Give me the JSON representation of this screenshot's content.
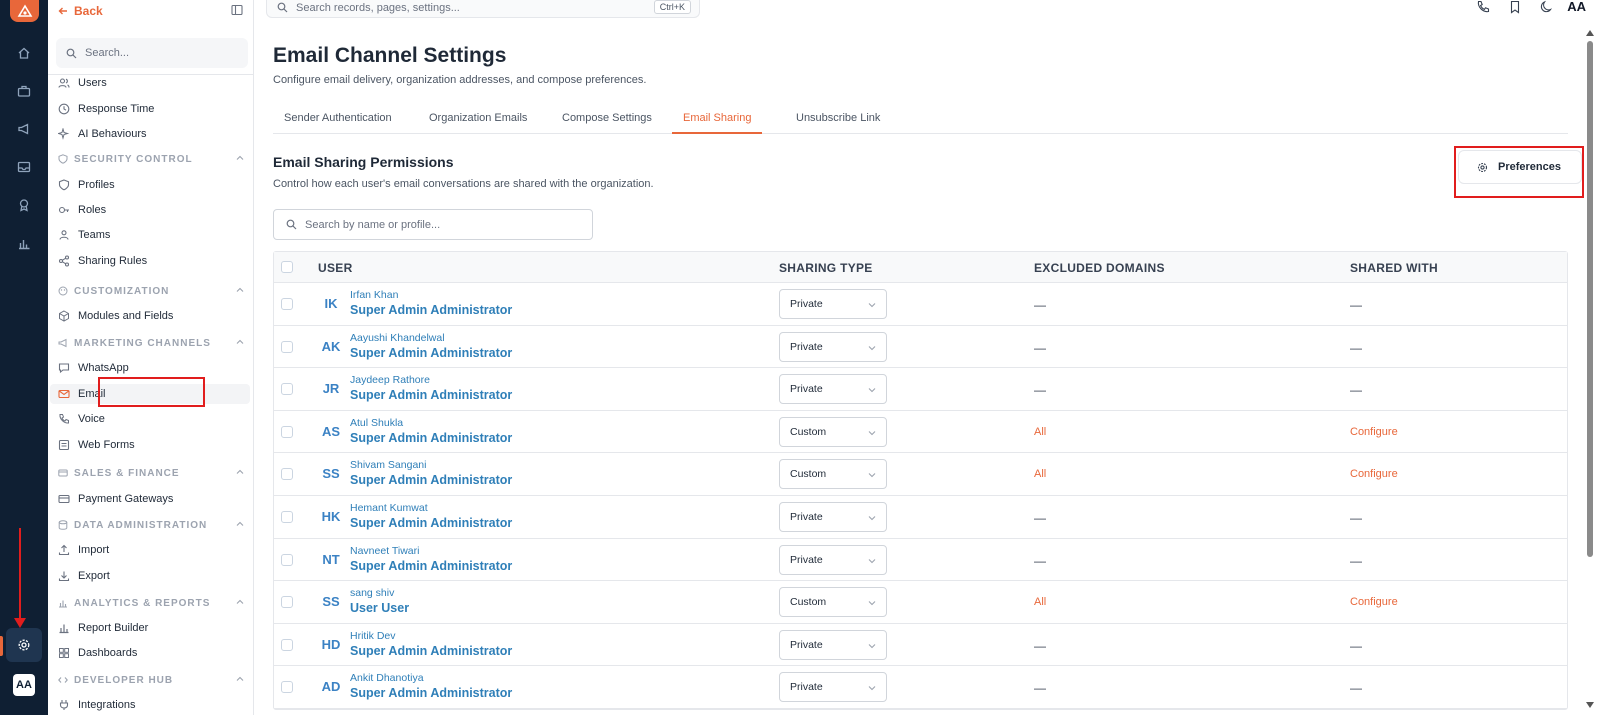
{
  "top": {
    "search_placeholder": "Search records, pages, settings...",
    "shortcut": "Ctrl+K",
    "avatar": "AA"
  },
  "rail": {
    "icons": [
      "home-icon",
      "briefcase-icon",
      "megaphone-icon",
      "inbox-icon",
      "badge-icon",
      "bar-chart-icon",
      "settings-icon"
    ],
    "avatar": "AA"
  },
  "sidebar": {
    "back_label": "Back",
    "search_placeholder": "Search...",
    "items_top": [
      {
        "label": "Users",
        "icon": "users-icon"
      },
      {
        "label": "Response Time",
        "icon": "clock-icon"
      },
      {
        "label": "AI Behaviours",
        "icon": "sparkle-icon"
      }
    ],
    "security": {
      "heading": "SECURITY CONTROL",
      "items": [
        {
          "label": "Profiles",
          "icon": "shield-icon"
        },
        {
          "label": "Roles",
          "icon": "key-icon"
        },
        {
          "label": "Teams",
          "icon": "team-icon"
        },
        {
          "label": "Sharing Rules",
          "icon": "share-icon"
        }
      ]
    },
    "customization": {
      "heading": "CUSTOMIZATION",
      "items": [
        {
          "label": "Modules and Fields",
          "icon": "cube-icon"
        }
      ]
    },
    "marketing": {
      "heading": "MARKETING CHANNELS",
      "items": [
        {
          "label": "WhatsApp",
          "icon": "chat-icon"
        },
        {
          "label": "Email",
          "icon": "mail-icon"
        },
        {
          "label": "Voice",
          "icon": "phone-icon"
        },
        {
          "label": "Web Forms",
          "icon": "form-icon"
        }
      ]
    },
    "sales": {
      "heading": "SALES & FINANCE",
      "items": [
        {
          "label": "Payment Gateways",
          "icon": "card-icon"
        }
      ]
    },
    "data_admin": {
      "heading": "DATA ADMINISTRATION",
      "items": [
        {
          "label": "Import",
          "icon": "upload-icon"
        },
        {
          "label": "Export",
          "icon": "download-icon"
        }
      ]
    },
    "analytics": {
      "heading": "ANALYTICS & REPORTS",
      "items": [
        {
          "label": "Report Builder",
          "icon": "chart-icon"
        },
        {
          "label": "Dashboards",
          "icon": "grid-icon"
        }
      ]
    },
    "developer": {
      "heading": "DEVELOPER HUB",
      "items": [
        {
          "label": "Integrations",
          "icon": "plug-icon"
        }
      ]
    }
  },
  "page": {
    "title": "Email Channel Settings",
    "subtitle": "Configure email delivery, organization addresses, and compose preferences.",
    "tabs": [
      "Sender Authentication",
      "Organization Emails",
      "Compose Settings",
      "Email Sharing",
      "Unsubscribe Link"
    ],
    "active_tab": "Email Sharing"
  },
  "section": {
    "title": "Email Sharing Permissions",
    "subtitle": "Control how each user's email conversations are shared with the organization.",
    "preferences_label": "Preferences",
    "search_placeholder": "Search by name or profile..."
  },
  "table": {
    "headers": {
      "user": "USER",
      "sharing_type": "SHARING TYPE",
      "excluded_domains": "EXCLUDED DOMAINS",
      "shared_with": "SHARED WITH"
    },
    "rows": [
      {
        "initials": "IK",
        "name": "Irfan Khan",
        "profile": "Super Admin Administrator",
        "sharing": "Private",
        "excluded": "—",
        "shared": "—"
      },
      {
        "initials": "AK",
        "name": "Aayushi Khandelwal",
        "profile": "Super Admin Administrator",
        "sharing": "Private",
        "excluded": "—",
        "shared": "—"
      },
      {
        "initials": "JR",
        "name": "Jaydeep Rathore",
        "profile": "Super Admin Administrator",
        "sharing": "Private",
        "excluded": "—",
        "shared": "—"
      },
      {
        "initials": "AS",
        "name": "Atul Shukla",
        "profile": "Super Admin Administrator",
        "sharing": "Custom",
        "excluded": "All",
        "shared": "Configure"
      },
      {
        "initials": "SS",
        "name": "Shivam Sangani",
        "profile": "Super Admin Administrator",
        "sharing": "Custom",
        "excluded": "All",
        "shared": "Configure"
      },
      {
        "initials": "HK",
        "name": "Hemant Kumwat",
        "profile": "Super Admin Administrator",
        "sharing": "Private",
        "excluded": "—",
        "shared": "—"
      },
      {
        "initials": "NT",
        "name": "Navneet Tiwari",
        "profile": "Super Admin Administrator",
        "sharing": "Private",
        "excluded": "—",
        "shared": "—"
      },
      {
        "initials": "SS",
        "name": "sang shiv",
        "profile": "User User",
        "sharing": "Custom",
        "excluded": "All",
        "shared": "Configure"
      },
      {
        "initials": "HD",
        "name": "Hritik Dev",
        "profile": "Super Admin Administrator",
        "sharing": "Private",
        "excluded": "—",
        "shared": "—"
      },
      {
        "initials": "AD",
        "name": "Ankit Dhanotiya",
        "profile": "Super Admin Administrator",
        "sharing": "Private",
        "excluded": "—",
        "shared": "—"
      }
    ]
  },
  "colors": {
    "accent": "#e8673a",
    "rail_bg": "#0f1f33",
    "link_blue": "#2f7fb8",
    "annotation_red": "#e11d1d"
  }
}
